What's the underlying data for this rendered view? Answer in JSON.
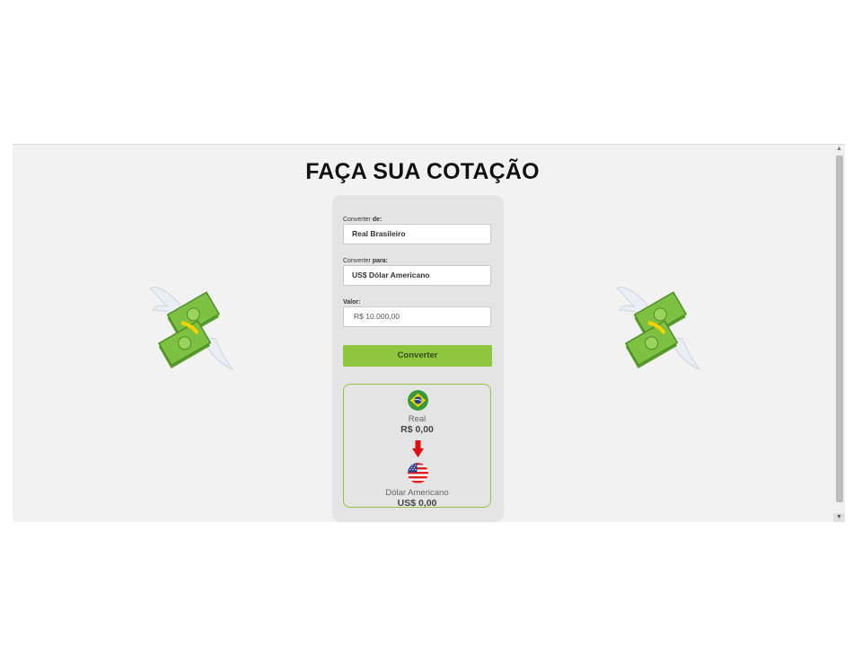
{
  "page": {
    "title": "FAÇA SUA COTAÇÃO"
  },
  "form": {
    "from_label_prefix": "Converter ",
    "from_label_bold": "de:",
    "from_value": "Real Brasileiro",
    "to_label_prefix": "Converter ",
    "to_label_bold": "para:",
    "to_value": "US$ Dólar Americano",
    "amount_label": "Valor:",
    "amount_value": "R$ 10.000,00",
    "convert_button": "Converter"
  },
  "result": {
    "from_currency": "Real",
    "from_amount": "R$ 0,00",
    "to_currency": "Dólar Americano",
    "to_amount": "US$ 0,00"
  },
  "icons": {
    "left_decoration": "flying-money-icon",
    "right_decoration": "flying-money-icon",
    "from_flag": "brazil-flag-icon",
    "to_flag": "usa-flag-icon",
    "arrow": "arrow-down-icon"
  },
  "colors": {
    "accent": "#8dc63f",
    "arrow": "#e01010",
    "card": "#e4e4e4"
  }
}
